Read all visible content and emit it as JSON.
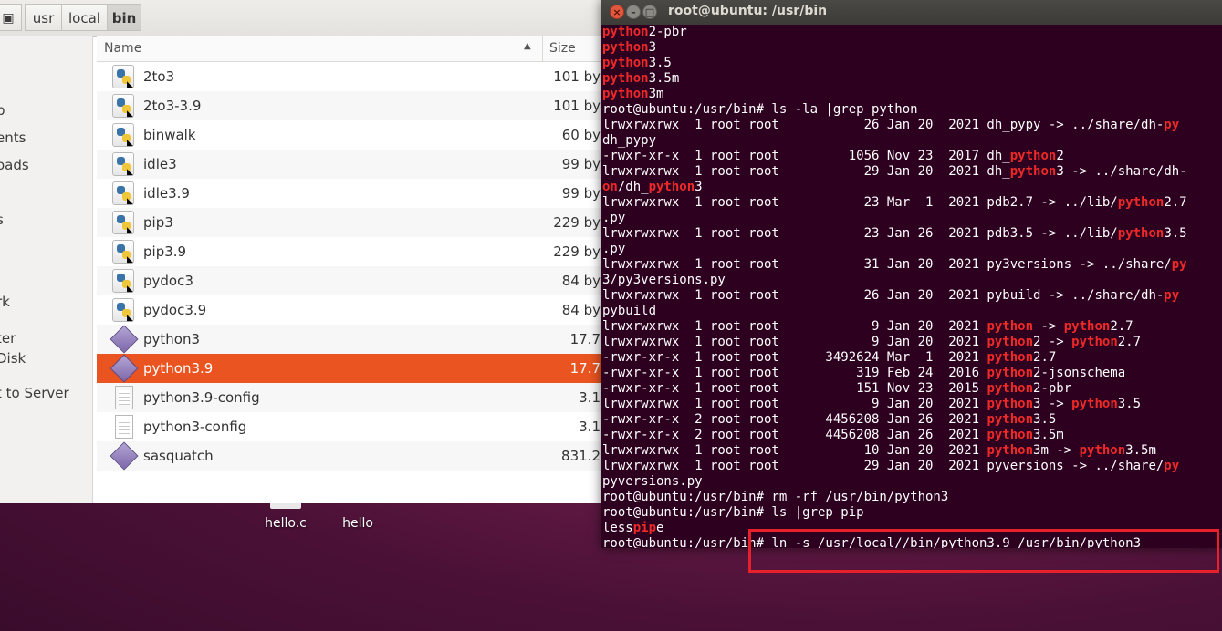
{
  "file_manager": {
    "breadcrumb": [
      "usr",
      "local",
      "bin"
    ],
    "sidebar": [
      "p",
      "ents",
      "oads",
      "s",
      "rk",
      "ter",
      "Disk",
      "t to Server"
    ],
    "columns": {
      "name": "Name",
      "size": "Size"
    },
    "files": [
      {
        "name": "2to3",
        "size": "101 by",
        "icon": "python-script-icon"
      },
      {
        "name": "2to3-3.9",
        "size": "101 by",
        "icon": "python-script-icon"
      },
      {
        "name": "binwalk",
        "size": "60 by",
        "icon": "python-script-icon"
      },
      {
        "name": "idle3",
        "size": "99 by",
        "icon": "python-script-icon"
      },
      {
        "name": "idle3.9",
        "size": "99 by",
        "icon": "python-script-icon"
      },
      {
        "name": "pip3",
        "size": "229 by",
        "icon": "python-script-icon"
      },
      {
        "name": "pip3.9",
        "size": "229 by",
        "icon": "python-script-icon"
      },
      {
        "name": "pydoc3",
        "size": "84 by",
        "icon": "python-script-icon"
      },
      {
        "name": "pydoc3.9",
        "size": "84 by",
        "icon": "python-script-icon"
      },
      {
        "name": "python3",
        "size": "17.7",
        "icon": "executable-icon"
      },
      {
        "name": "python3.9",
        "size": "17.7",
        "icon": "executable-icon",
        "selected": true
      },
      {
        "name": "python3.9-config",
        "size": "3.1",
        "icon": "text-document-icon"
      },
      {
        "name": "python3-config",
        "size": "3.1",
        "icon": "text-document-icon"
      },
      {
        "name": "sasquatch",
        "size": "831.2",
        "icon": "executable-icon"
      }
    ]
  },
  "desktop": {
    "icons": [
      "hello.c",
      "hello"
    ]
  },
  "terminal": {
    "title": "root@ubuntu: /usr/bin",
    "highlight_color": "#e8202a",
    "lines": [
      [
        [
          "python",
          1
        ],
        [
          "2-pbr",
          0
        ]
      ],
      [
        [
          "python",
          1
        ],
        [
          "3",
          0
        ]
      ],
      [
        [
          "python",
          1
        ],
        [
          "3.5",
          0
        ]
      ],
      [
        [
          "python",
          1
        ],
        [
          "3.5m",
          0
        ]
      ],
      [
        [
          "python",
          1
        ],
        [
          "3m",
          0
        ]
      ],
      [
        [
          "root@ubuntu:/usr/bin# ls -la |grep python",
          0
        ]
      ],
      [
        [
          "lrwxrwxrwx  1 root root           26 Jan 20  2021 dh_pypy -> ../share/dh-",
          0
        ],
        [
          "py",
          1
        ]
      ],
      [
        [
          "dh_pypy",
          0
        ]
      ],
      [
        [
          "-rwxr-xr-x  1 root root         1056 Nov 23  2017 dh_",
          0
        ],
        [
          "python",
          1
        ],
        [
          "2",
          0
        ]
      ],
      [
        [
          "lrwxrwxrwx  1 root root           29 Jan 20  2021 dh_",
          0
        ],
        [
          "python",
          1
        ],
        [
          "3 -> ../share/dh-",
          0
        ]
      ],
      [
        [
          "on",
          1
        ],
        [
          "/dh_",
          0
        ],
        [
          "python",
          1
        ],
        [
          "3",
          0
        ]
      ],
      [
        [
          "lrwxrwxrwx  1 root root           23 Mar  1  2021 pdb2.7 -> ../lib/",
          0
        ],
        [
          "python",
          1
        ],
        [
          "2.7",
          0
        ]
      ],
      [
        [
          ".py",
          0
        ]
      ],
      [
        [
          "lrwxrwxrwx  1 root root           23 Jan 26  2021 pdb3.5 -> ../lib/",
          0
        ],
        [
          "python",
          1
        ],
        [
          "3.5",
          0
        ]
      ],
      [
        [
          ".py",
          0
        ]
      ],
      [
        [
          "lrwxrwxrwx  1 root root           31 Jan 20  2021 py3versions -> ../share/",
          0
        ],
        [
          "py",
          1
        ]
      ],
      [
        [
          "3/py3versions.py",
          0
        ]
      ],
      [
        [
          "lrwxrwxrwx  1 root root           26 Jan 20  2021 pybuild -> ../share/dh-",
          0
        ],
        [
          "py",
          1
        ]
      ],
      [
        [
          "pybuild",
          0
        ]
      ],
      [
        [
          "lrwxrwxrwx  1 root root            9 Jan 20  2021 ",
          0
        ],
        [
          "python",
          1
        ],
        [
          " -> ",
          0
        ],
        [
          "python",
          1
        ],
        [
          "2.7",
          0
        ]
      ],
      [
        [
          "lrwxrwxrwx  1 root root            9 Jan 20  2021 ",
          0
        ],
        [
          "python",
          1
        ],
        [
          "2 -> ",
          0
        ],
        [
          "python",
          1
        ],
        [
          "2.7",
          0
        ]
      ],
      [
        [
          "-rwxr-xr-x  1 root root      3492624 Mar  1  2021 ",
          0
        ],
        [
          "python",
          1
        ],
        [
          "2.7",
          0
        ]
      ],
      [
        [
          "-rwxr-xr-x  1 root root          319 Feb 24  2016 ",
          0
        ],
        [
          "python",
          1
        ],
        [
          "2-jsonschema",
          0
        ]
      ],
      [
        [
          "-rwxr-xr-x  1 root root          151 Nov 23  2015 ",
          0
        ],
        [
          "python",
          1
        ],
        [
          "2-pbr",
          0
        ]
      ],
      [
        [
          "lrwxrwxrwx  1 root root            9 Jan 20  2021 ",
          0
        ],
        [
          "python",
          1
        ],
        [
          "3 -> ",
          0
        ],
        [
          "python",
          1
        ],
        [
          "3.5",
          0
        ]
      ],
      [
        [
          "-rwxr-xr-x  2 root root      4456208 Jan 26  2021 ",
          0
        ],
        [
          "python",
          1
        ],
        [
          "3.5",
          0
        ]
      ],
      [
        [
          "-rwxr-xr-x  2 root root      4456208 Jan 26  2021 ",
          0
        ],
        [
          "python",
          1
        ],
        [
          "3.5m",
          0
        ]
      ],
      [
        [
          "lrwxrwxrwx  1 root root           10 Jan 20  2021 ",
          0
        ],
        [
          "python",
          1
        ],
        [
          "3m -> ",
          0
        ],
        [
          "python",
          1
        ],
        [
          "3.5m",
          0
        ]
      ],
      [
        [
          "lrwxrwxrwx  1 root root           29 Jan 20  2021 pyversions -> ../share/",
          0
        ],
        [
          "py",
          1
        ]
      ],
      [
        [
          "pyversions.py",
          0
        ]
      ],
      [
        [
          "root@ubuntu:/usr/bin# rm -rf /usr/bin/python3",
          0
        ]
      ],
      [
        [
          "root@ubuntu:/usr/bin# ls |grep pip",
          0
        ]
      ],
      [
        [
          "less",
          0
        ],
        [
          "pip",
          1
        ],
        [
          "e",
          0
        ]
      ],
      [
        [
          "root@ubuntu:/usr/bin# ln -s /usr/local//bin/python3.9 /usr/bin/python3",
          0
        ]
      ]
    ]
  }
}
